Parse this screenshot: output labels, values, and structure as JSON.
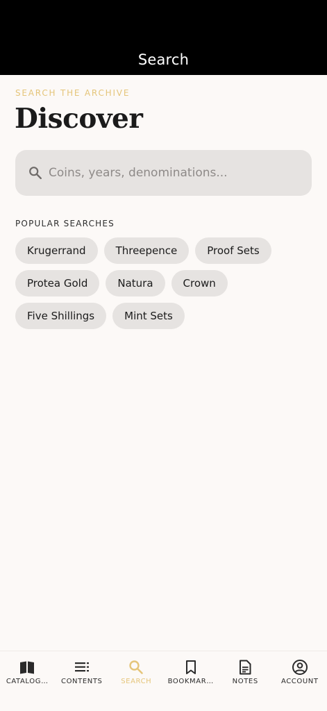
{
  "header": {
    "title": "Search"
  },
  "page": {
    "eyebrow": "SEARCH THE ARCHIVE",
    "headline": "Discover"
  },
  "search": {
    "placeholder": "Coins, years, denominations...",
    "value": "",
    "icon": "search-icon"
  },
  "popular": {
    "label": "POPULAR SEARCHES",
    "rows": [
      [
        "Krugerrand",
        "Threepence",
        "Proof Sets"
      ],
      [
        "Protea Gold",
        "Natura",
        "Crown"
      ],
      [
        "Five Shillings",
        "Mint Sets"
      ]
    ]
  },
  "nav": {
    "active": "SEARCH",
    "items": [
      {
        "label": "CATALOG…",
        "icon": "book-open-icon"
      },
      {
        "label": "CONTENTS",
        "icon": "list-icon"
      },
      {
        "label": "SEARCH",
        "icon": "search-icon"
      },
      {
        "label": "BOOKMAR…",
        "icon": "bookmark-icon"
      },
      {
        "label": "NOTES",
        "icon": "document-icon"
      },
      {
        "label": "ACCOUNT",
        "icon": "account-circle-icon"
      }
    ]
  },
  "colors": {
    "accent": "#E5C57A",
    "header_bg": "#000000",
    "background": "#FCF9F7",
    "chip_bg": "#E6E3E1",
    "text": "#1B1B1B"
  }
}
